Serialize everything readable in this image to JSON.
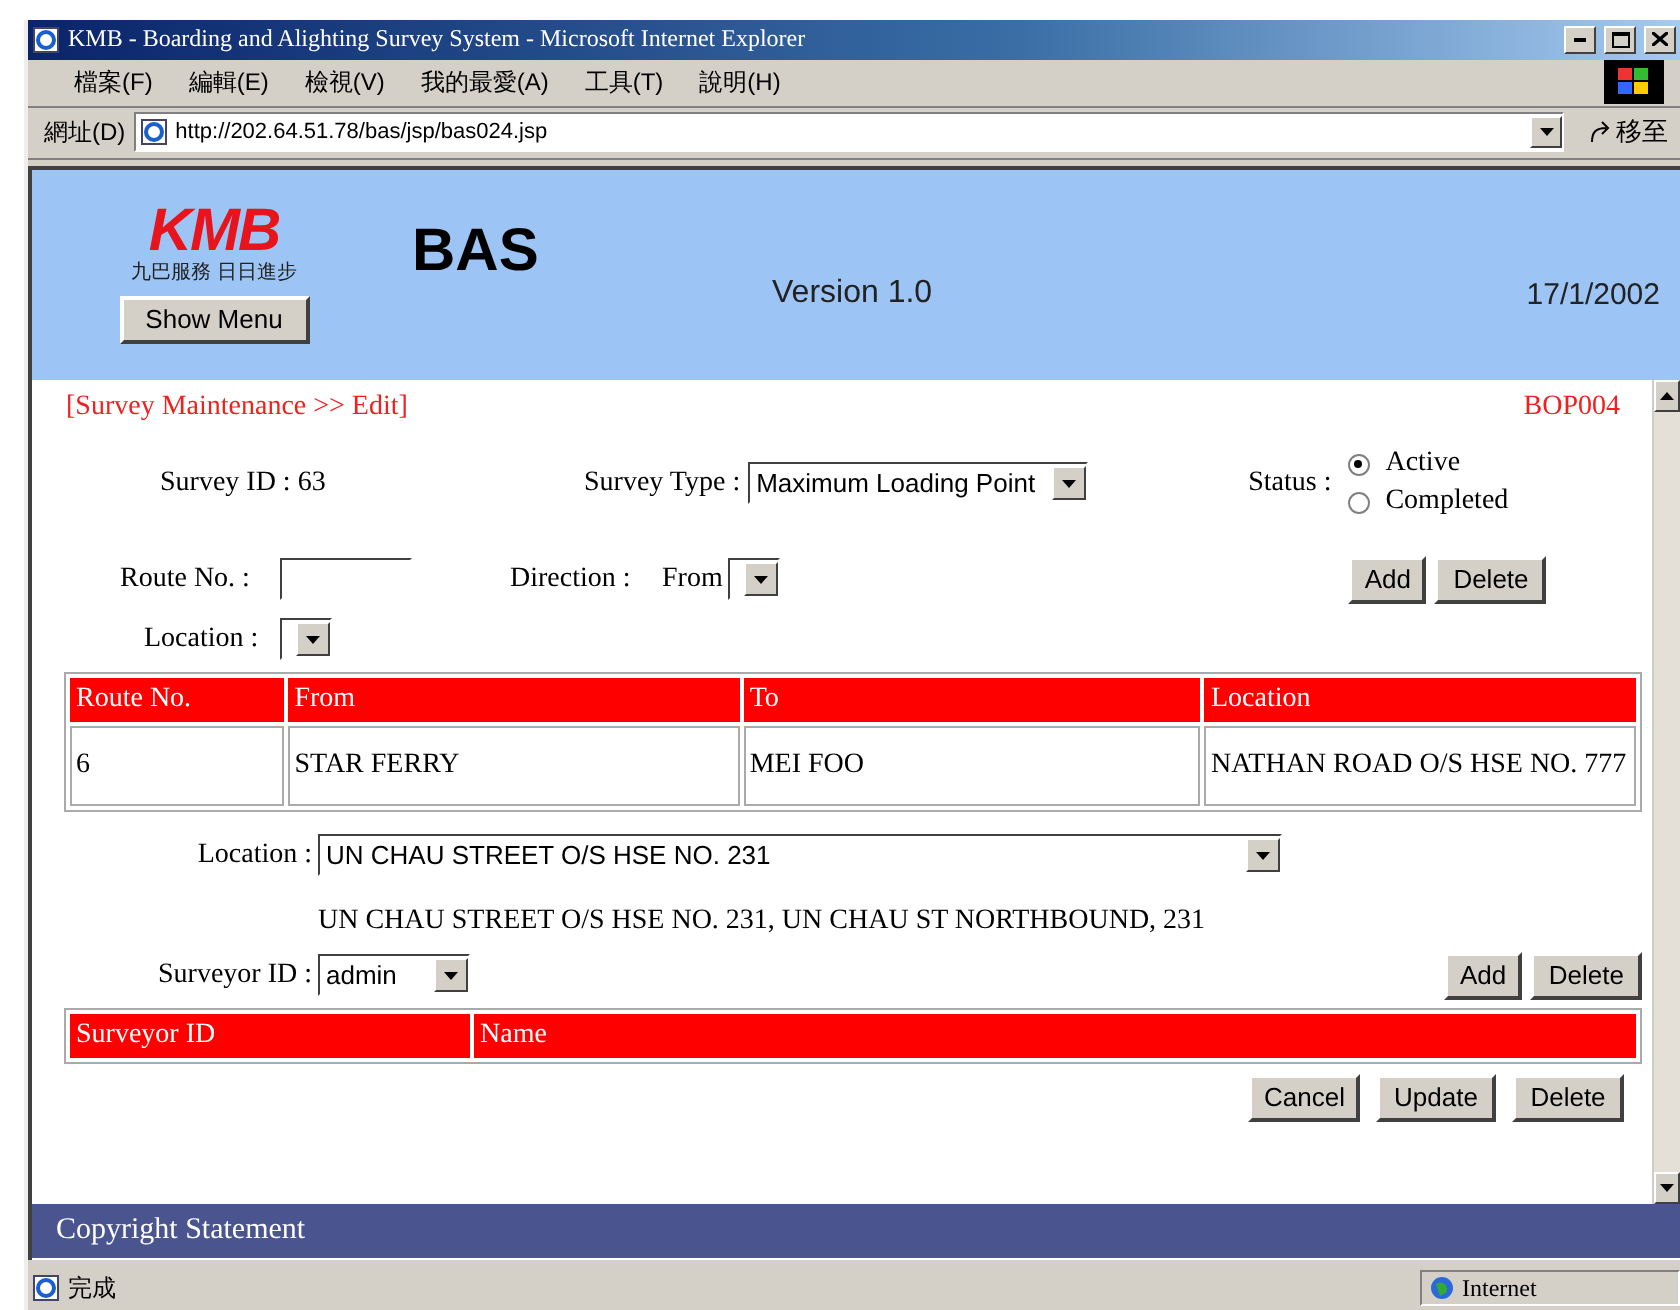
{
  "window": {
    "title": "KMB - Boarding and Alighting Survey System - Microsoft Internet Explorer"
  },
  "menu": [
    "檔案(F)",
    "編輯(E)",
    "檢視(V)",
    "我的最愛(A)",
    "工具(T)",
    "說明(H)"
  ],
  "address": {
    "label": "網址(D)",
    "url": "http://202.64.51.78/bas/jsp/bas024.jsp",
    "go": "移至"
  },
  "header": {
    "logo_mark": "KMB",
    "logo_tagline": "九巴服務 日日進步",
    "show_menu": "Show Menu",
    "app": "BAS",
    "version": "Version 1.0",
    "date": "17/1/2002"
  },
  "breadcrumb": "[Survey Maintenance >> Edit]",
  "page_code": "BOP004",
  "survey_id": "Survey ID : 63",
  "survey_type": {
    "label": "Survey Type :",
    "value": "Maximum Loading Point"
  },
  "status": {
    "label": "Status :",
    "options": [
      {
        "label": "Active",
        "selected": true
      },
      {
        "label": "Completed",
        "selected": false
      }
    ]
  },
  "route_form": {
    "route_label": "Route No. :",
    "direction_label": "Direction :",
    "direction_from": "From",
    "location_label": "Location :",
    "buttons": [
      "Add",
      "Delete"
    ]
  },
  "routes_table": {
    "columns": [
      "Route No.",
      "From",
      "To",
      "Location"
    ],
    "rows": [
      [
        "6",
        "STAR FERRY",
        "MEI FOO",
        "NATHAN ROAD O/S HSE NO. 777"
      ]
    ]
  },
  "location": {
    "label": "Location :",
    "value": "UN CHAU STREET O/S HSE NO. 231",
    "description": "UN CHAU STREET O/S HSE NO. 231, UN CHAU ST NORTHBOUND, 231"
  },
  "surveyor": {
    "label": "Surveyor ID :",
    "value": "admin",
    "buttons": [
      "Add",
      "Delete"
    ]
  },
  "surveyors_table": {
    "columns": [
      "Surveyor ID",
      "Name"
    ]
  },
  "actions": [
    "Cancel",
    "Update",
    "Delete"
  ],
  "footer": "Copyright Statement",
  "status_bar": {
    "text": "完成",
    "zone": "Internet"
  }
}
